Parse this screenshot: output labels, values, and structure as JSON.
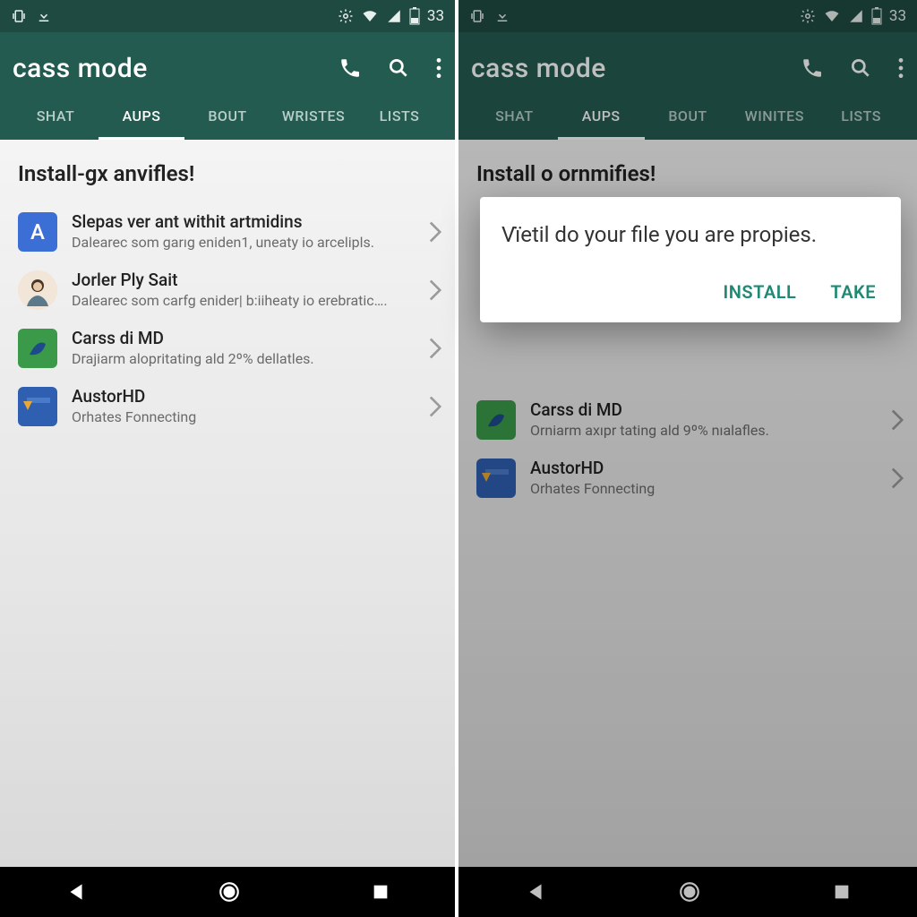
{
  "status": {
    "battery": "33"
  },
  "appbar": {
    "title": "cass mode"
  },
  "tabs": [
    "SHAT",
    "AUPS",
    "BOUT",
    "WRISTES",
    "LISTS"
  ],
  "tabs_r": [
    "SHAT",
    "AUPS",
    "BOUT",
    "WINITES",
    "LISTS"
  ],
  "active_tab_index": 1,
  "left": {
    "heading": "Install-gx anvifles!",
    "items": [
      {
        "title": "Slepas ver ant withit artmidins",
        "sub": "Dalearec som garıg eniden1, uneaty io arcelipls."
      },
      {
        "title": "Jorler Ply Sait",
        "sub": "Dalearec som carfg enider| b:iiheaty io erebratic…."
      },
      {
        "title": "Carss di MD",
        "sub": "Drajiarm alopritating ald 2º% dellatles."
      },
      {
        "title": "AustorHD",
        "sub": "Orhates Fonnecting"
      }
    ]
  },
  "right": {
    "heading": "Install o ornmifies!",
    "items": [
      {
        "title": "Carss di MD",
        "sub": "Orniarm axıpr tating ald 9º% nıalafles."
      },
      {
        "title": "AustorHD",
        "sub": "Orhates Fonnecting"
      }
    ]
  },
  "dialog": {
    "text": "Vïetil do your file you are propies.",
    "install": "INSTALL",
    "take": "TAKE"
  }
}
